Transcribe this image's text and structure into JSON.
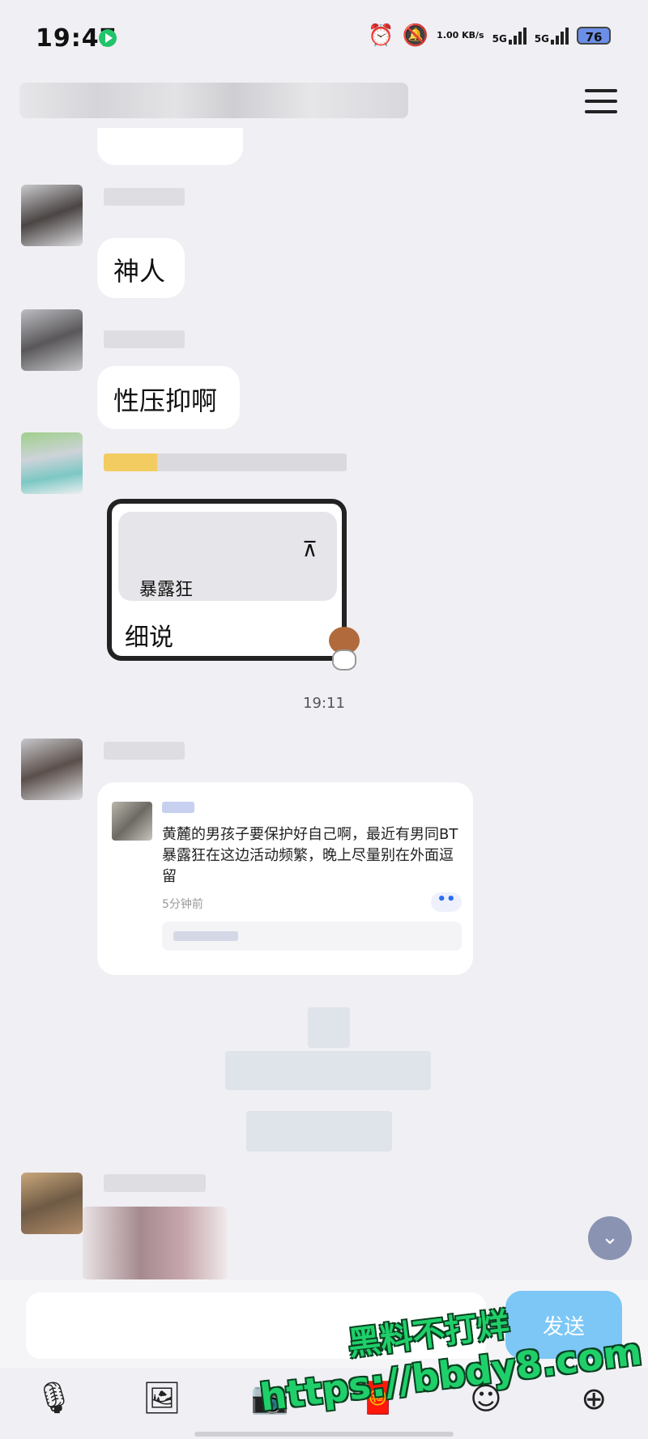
{
  "status_bar": {
    "time": "19:47",
    "net_speed": "1.00 KB/s",
    "signal_labels": [
      "5G",
      "5G"
    ],
    "battery": "76",
    "icons": [
      "play-icon",
      "alarm-icon",
      "mute-bell-icon"
    ]
  },
  "chat": {
    "messages": [
      {
        "text": "神人"
      },
      {
        "text": "性压抑啊"
      }
    ],
    "sticker": {
      "quote": "暴露狂",
      "reply": "细说"
    },
    "timestamp": "19:11",
    "shared_post": {
      "body": "黄麓的男孩子要保护好自己啊，最近有男同BT暴露狂在这边活动频繁，晚上尽量别在外面逗留",
      "time": "5分钟前",
      "more": "••"
    }
  },
  "input": {
    "send_label": "发送"
  },
  "toolbar": {
    "icons": [
      "microphone-icon",
      "image-icon",
      "camera-icon",
      "red-packet-icon",
      "emoji-icon",
      "plus-icon"
    ]
  },
  "watermark": {
    "line1": "黑料不打烊",
    "line2": "https://bbdy8.com"
  },
  "colors": {
    "background": "#efeff4",
    "send_button": "#7cc7f6",
    "watermark": "#1fd06a"
  }
}
